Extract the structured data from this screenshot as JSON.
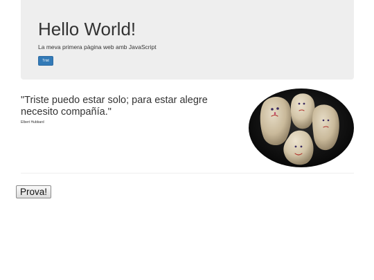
{
  "jumbotron": {
    "title": "Hello World!",
    "subtitle": "La meva primera pàgina web amb JavaScript",
    "button_label": "Trist"
  },
  "quote": {
    "text": "\"Triste puedo estar solo; para estar alegre necesito compañía.\"",
    "author": "Elbert Hubbard"
  },
  "image": {
    "subject": "painted-rocks-with-faces"
  },
  "action_button": {
    "label": "Prova!"
  }
}
